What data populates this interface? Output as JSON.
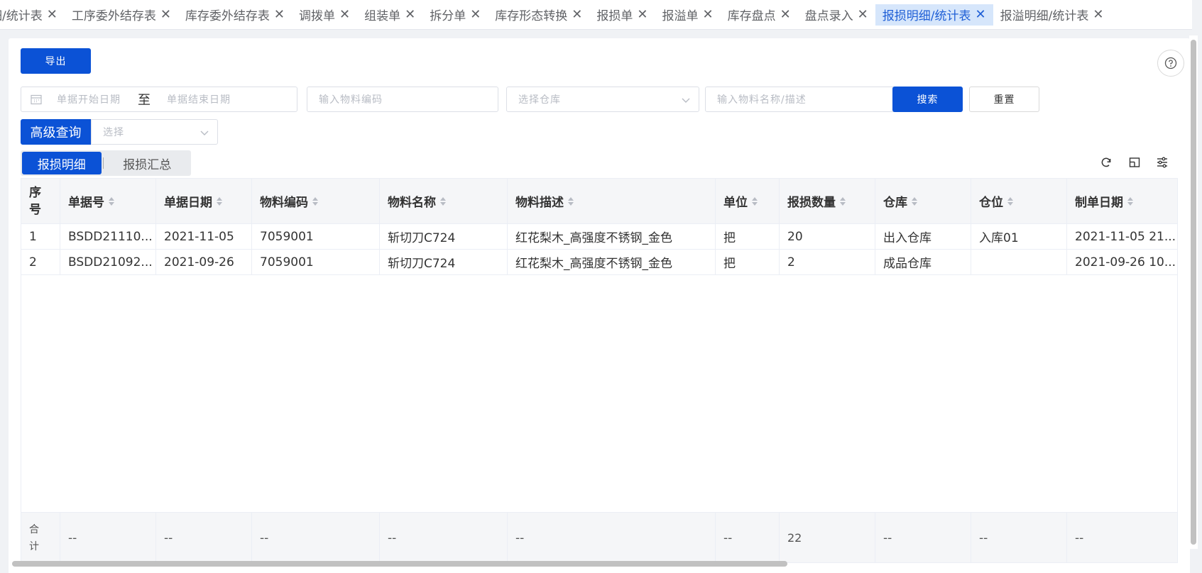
{
  "tabs": [
    {
      "label": "明细/统计表",
      "display": "细/统计表",
      "active": false
    },
    {
      "label": "工序委外结存表",
      "active": false
    },
    {
      "label": "库存委外结存表",
      "active": false
    },
    {
      "label": "调拨单",
      "active": false
    },
    {
      "label": "组装单",
      "active": false
    },
    {
      "label": "拆分单",
      "active": false
    },
    {
      "label": "库存形态转换",
      "active": false
    },
    {
      "label": "报损单",
      "active": false
    },
    {
      "label": "报溢单",
      "active": false
    },
    {
      "label": "库存盘点",
      "active": false
    },
    {
      "label": "盘点录入",
      "active": false
    },
    {
      "label": "报损明细/统计表",
      "active": true
    },
    {
      "label": "报溢明细/统计表",
      "active": false
    }
  ],
  "toolbar": {
    "export_label": "导出",
    "help_icon": "question-circle-icon"
  },
  "filters": {
    "date_start_placeholder": "单据开始日期",
    "date_separator": "至",
    "date_end_placeholder": "单据结束日期",
    "material_code_placeholder": "输入物料编码",
    "warehouse_placeholder": "选择仓库",
    "material_name_placeholder": "输入物料名称/描述",
    "search_label": "搜索",
    "reset_label": "重置",
    "advanced_label": "高级查询",
    "advanced_select_placeholder": "选择"
  },
  "view_tabs": {
    "detail": "报损明细",
    "summary": "报损汇总"
  },
  "table": {
    "headers": [
      {
        "seq_line1": "序",
        "seq_line2": "号"
      },
      "单据号",
      "单据日期",
      "物料编码",
      "物料名称",
      "物料描述",
      "单位",
      "报损数量",
      "仓库",
      "仓位",
      "制单日期"
    ],
    "rows": [
      [
        "1",
        "BSDD21110...",
        "2021-11-05",
        "7059001",
        "斩切刀C724",
        "红花梨木_高强度不锈钢_金色",
        "把",
        "20",
        "出入仓库",
        "入库01",
        "2021-11-05 21..."
      ],
      [
        "2",
        "BSDD21092...",
        "2021-09-26",
        "7059001",
        "斩切刀C724",
        "红花梨木_高强度不锈钢_金色",
        "把",
        "2",
        "成品仓库",
        "",
        "2021-09-26 10..."
      ]
    ],
    "footer": {
      "label_line1": "合",
      "label_line2": "计",
      "cells": [
        "--",
        "--",
        "--",
        "--",
        "--",
        "--",
        "22",
        "--",
        "--",
        "--"
      ]
    }
  },
  "colors": {
    "primary": "#0b52d6",
    "active_tab_bg": "#d6e6fb",
    "active_tab_text": "#1f5fd6"
  }
}
